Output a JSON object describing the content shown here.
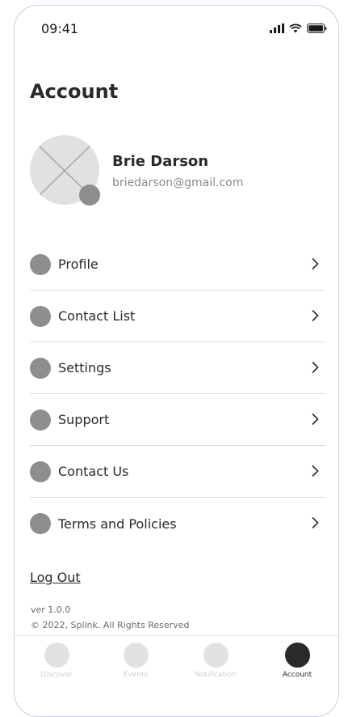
{
  "status_bar": {
    "time": "09:41",
    "icons": [
      "signal-icon",
      "wifi-icon",
      "battery-icon"
    ]
  },
  "header": {
    "title": "Account"
  },
  "profile": {
    "name": "Brie Darson",
    "email": "briedarson@gmail.com"
  },
  "menu": {
    "items": [
      {
        "label": "Profile"
      },
      {
        "label": "Contact List"
      },
      {
        "label": "Settings"
      },
      {
        "label": "Support"
      },
      {
        "label": "Contact Us"
      },
      {
        "label": "Terms and Policies"
      }
    ]
  },
  "logout": {
    "label": "Log Out"
  },
  "footer": {
    "version": "ver 1.0.0",
    "copyright": "© 2022, Splink. All Rights Reserved"
  },
  "tab_bar": {
    "tabs": [
      {
        "label": "Discover",
        "active": false
      },
      {
        "label": "Events",
        "active": false
      },
      {
        "label": "Notification",
        "active": false
      },
      {
        "label": "Account",
        "active": true
      }
    ]
  },
  "colors": {
    "accent": "#2a2a2a",
    "icon_gray": "#8e8e8e",
    "placeholder": "#e2e2e2",
    "frame": "#c9cdea"
  }
}
